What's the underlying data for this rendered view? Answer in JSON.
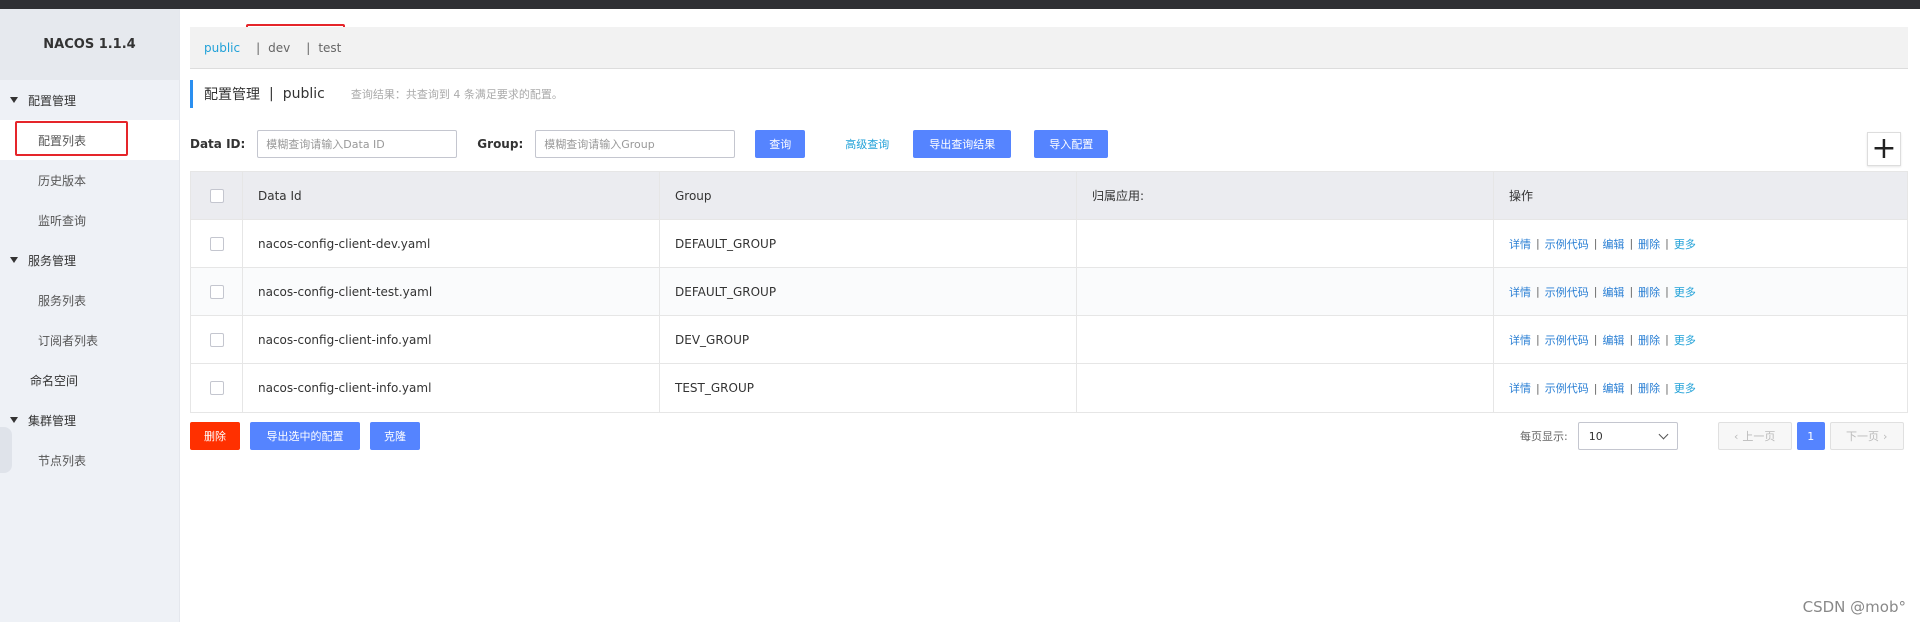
{
  "app": {
    "logo": "NACOS 1.1.4"
  },
  "sidebar": {
    "groups": [
      {
        "label": "配置管理",
        "items": [
          "配置列表",
          "历史版本",
          "监听查询"
        ]
      },
      {
        "label": "服务管理",
        "items": [
          "服务列表",
          "订阅者列表"
        ]
      }
    ],
    "plain_item": "命名空间",
    "cluster": {
      "label": "集群管理",
      "items": [
        "节点列表"
      ]
    },
    "active_item": "配置列表"
  },
  "namespaces": {
    "items": [
      "public",
      "dev",
      "test"
    ],
    "separator": "|",
    "active": "public"
  },
  "page": {
    "title": "配置管理",
    "title_sep": "|",
    "namespace": "public",
    "result_hint": "查询结果：共查询到 4 条满足要求的配置。"
  },
  "filters": {
    "data_id_label": "Data ID:",
    "data_id_placeholder": "模糊查询请输入Data ID",
    "group_label": "Group:",
    "group_placeholder": "模糊查询请输入Group",
    "query_button": "查询",
    "advanced_query": "高级查询",
    "export_results_button": "导出查询结果",
    "import_button": "导入配置",
    "add_icon": "plus-icon"
  },
  "table": {
    "columns": [
      "Data Id",
      "Group",
      "归属应用:",
      "操作"
    ],
    "rows": [
      {
        "data_id": "nacos-config-client-dev.yaml",
        "group": "DEFAULT_GROUP",
        "app": ""
      },
      {
        "data_id": "nacos-config-client-test.yaml",
        "group": "DEFAULT_GROUP",
        "app": ""
      },
      {
        "data_id": "nacos-config-client-info.yaml",
        "group": "DEV_GROUP",
        "app": ""
      },
      {
        "data_id": "nacos-config-client-info.yaml",
        "group": "TEST_GROUP",
        "app": ""
      }
    ],
    "operations": {
      "detail": "详情",
      "sample_code": "示例代码",
      "edit": "编辑",
      "delete": "删除",
      "more": "更多",
      "sep": "|"
    }
  },
  "bulk": {
    "delete": "删除",
    "export_selected": "导出选中的配置",
    "clone": "克隆"
  },
  "pagination": {
    "page_size_label": "每页显示:",
    "page_size": "10",
    "prev": "上一页",
    "current_page": "1",
    "next": "下一页"
  },
  "watermark": "CSDN @mob°",
  "colors": {
    "primary": "#5584ff",
    "danger": "#ff3000",
    "link": "#21a1d8",
    "highlight_box": "#e5252a"
  }
}
